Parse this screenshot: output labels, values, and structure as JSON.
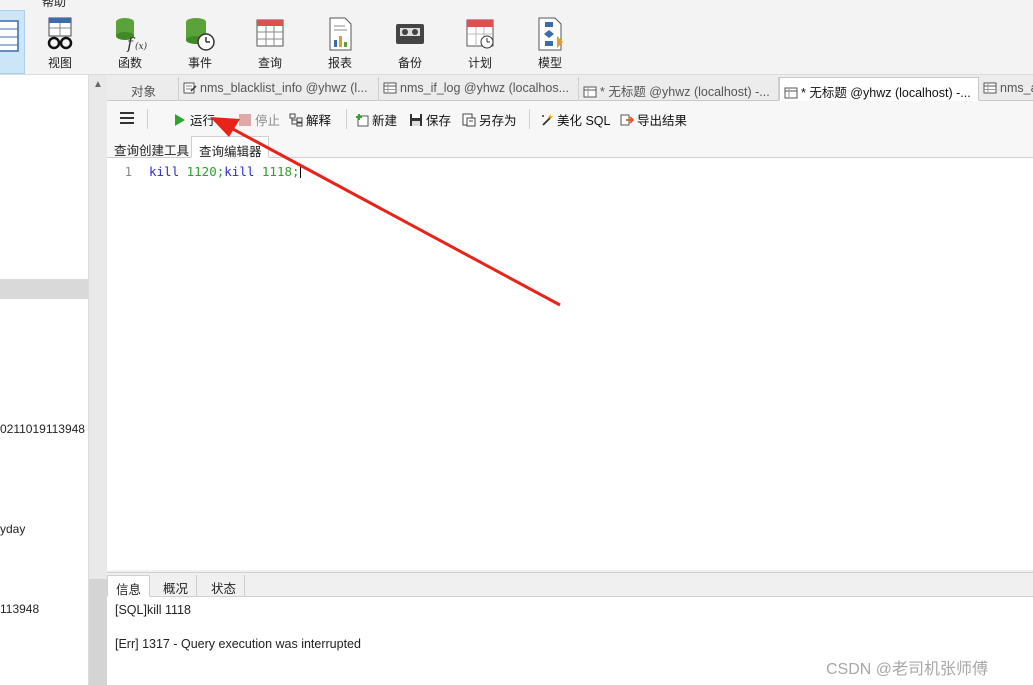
{
  "menu": {
    "help": "帮助"
  },
  "ribbon": {
    "items": [
      {
        "label": "视图",
        "icon": "glasses-grid-icon"
      },
      {
        "label": "函数",
        "icon": "function-db-icon"
      },
      {
        "label": "事件",
        "icon": "event-clock-icon"
      },
      {
        "label": "查询",
        "icon": "query-grid-icon"
      },
      {
        "label": "报表",
        "icon": "report-icon"
      },
      {
        "label": "备份",
        "icon": "tape-backup-icon"
      },
      {
        "label": "计划",
        "icon": "calendar-clock-icon"
      },
      {
        "label": "模型",
        "icon": "model-diagram-icon"
      }
    ]
  },
  "sidebar": {
    "texts": [
      "0211019113948",
      "yday",
      "113948"
    ]
  },
  "tabs": [
    {
      "label": "对象",
      "icon": ""
    },
    {
      "label": "nms_blacklist_info @yhwz (l...",
      "icon": "query-icon"
    },
    {
      "label": "nms_if_log @yhwz (localhos...",
      "icon": "table-icon"
    },
    {
      "label": "* 无标题 @yhwz (localhost) -...",
      "icon": "query-table-icon"
    },
    {
      "label": "* 无标题 @yhwz (localhost) -...",
      "icon": "query-table-icon"
    },
    {
      "label": "nms_a",
      "icon": "table-icon"
    }
  ],
  "toolbar": {
    "run": "运行",
    "stop": "停止",
    "explain": "解释",
    "new": "新建",
    "save": "保存",
    "save_as": "另存为",
    "beautify": "美化 SQL",
    "export": "导出结果"
  },
  "subtabs": {
    "builder": "查询创建工具",
    "editor": "查询编辑器"
  },
  "editor": {
    "line_number": "1",
    "code_kw1": "kill",
    "code_num1": " 1120;",
    "code_kw2": "kill",
    "code_num2": " 1118;"
  },
  "results": {
    "tabs": [
      "信息",
      "概况",
      "状态"
    ],
    "line1": "[SQL]kill 1118",
    "line2": "[Err] 1317 - Query execution was interrupted"
  },
  "watermark": "CSDN @老司机张师傅",
  "colors": {
    "accent_selection": "#cde6f7",
    "arrow": "#e8241a",
    "keyword": "#2b2bd6",
    "number": "#2fa02f"
  }
}
